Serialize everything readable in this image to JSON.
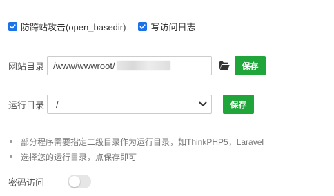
{
  "checkboxes": {
    "anti_cross": {
      "label": "防跨站攻击(open_basedir)",
      "checked": true
    },
    "access_log": {
      "label": "写访问日志",
      "checked": true
    }
  },
  "site_dir": {
    "label": "网站目录",
    "value": "/www/wwwroot/",
    "save_label": "保存"
  },
  "run_dir": {
    "label": "运行目录",
    "selected": "/",
    "save_label": "保存"
  },
  "tips": [
    "部分程序需要指定二级目录作为运行目录，如ThinkPHP5，Laravel",
    "选择您的运行目录，点保存即可"
  ],
  "password_access": {
    "label": "密码访问",
    "enabled": false
  },
  "colors": {
    "accent": "#20a53a",
    "checkbox": "#1a73e8"
  },
  "icons": {
    "folder": "folder-open-icon",
    "dropdown": "chevron-down-icon",
    "check": "check-icon"
  }
}
